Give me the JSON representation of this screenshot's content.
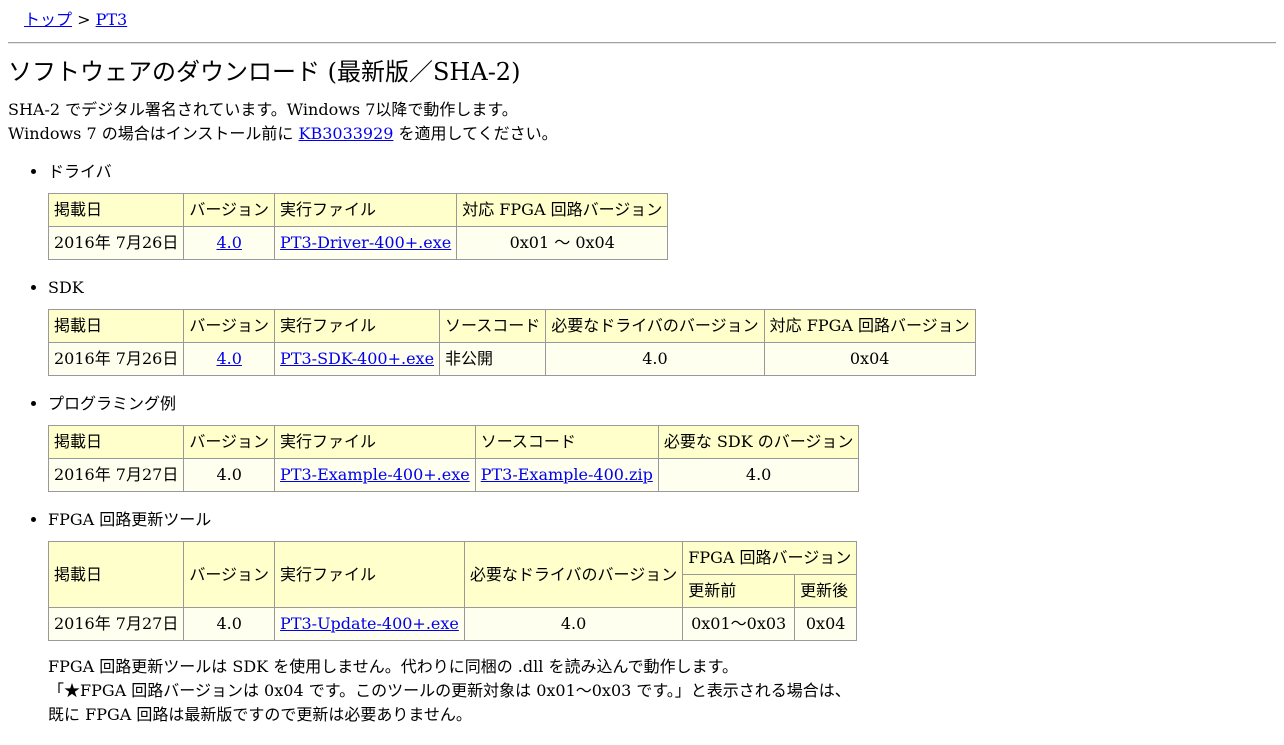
{
  "breadcrumb": {
    "top": "トップ",
    "sep": " > ",
    "current": "PT3"
  },
  "title": "ソフトウェアのダウンロード (最新版／SHA-2)",
  "intro": {
    "line1": "SHA-2 でデジタル署名されています。Windows 7以降で動作します。",
    "line2_before": "Windows 7 の場合はインストール前に ",
    "line2_link": "KB3033929",
    "line2_after": " を適用してください。"
  },
  "driver": {
    "heading": "ドライバ",
    "headers": [
      "掲載日",
      "バージョン",
      "実行ファイル",
      "対応 FPGA 回路バージョン"
    ],
    "row": {
      "date": "2016年 7月26日",
      "version": "4.0",
      "file": "PT3-Driver-400+.exe",
      "fpga": "0x01 ～ 0x04"
    }
  },
  "sdk": {
    "heading": "SDK",
    "headers": [
      "掲載日",
      "バージョン",
      "実行ファイル",
      "ソースコード",
      "必要なドライバのバージョン",
      "対応 FPGA 回路バージョン"
    ],
    "row": {
      "date": "2016年 7月26日",
      "version": "4.0",
      "file": "PT3-SDK-400+.exe",
      "source": "非公開",
      "driver": "4.0",
      "fpga": "0x04"
    }
  },
  "example": {
    "heading": "プログラミング例",
    "headers": [
      "掲載日",
      "バージョン",
      "実行ファイル",
      "ソースコード",
      "必要な SDK のバージョン"
    ],
    "row": {
      "date": "2016年 7月27日",
      "version": "4.0",
      "file": "PT3-Example-400+.exe",
      "source": "PT3-Example-400.zip",
      "sdk": "4.0"
    }
  },
  "update": {
    "heading": "FPGA 回路更新ツール",
    "headers": {
      "date": "掲載日",
      "version": "バージョン",
      "file": "実行ファイル",
      "driver": "必要なドライバのバージョン",
      "fpga": "FPGA 回路バージョン",
      "before": "更新前",
      "after": "更新後"
    },
    "row": {
      "date": "2016年 7月27日",
      "version": "4.0",
      "file": "PT3-Update-400+.exe",
      "driver": "4.0",
      "before": "0x01～0x03",
      "after": "0x04"
    },
    "notes": [
      "FPGA 回路更新ツールは SDK を使用しません。代わりに同梱の .dll を読み込んで動作します。",
      "「★FPGA 回路バージョンは 0x04 です。このツールの更新対象は 0x01～0x03 です。」と表示される場合は、",
      "既に FPGA 回路は最新版ですので更新は必要ありません。"
    ]
  }
}
